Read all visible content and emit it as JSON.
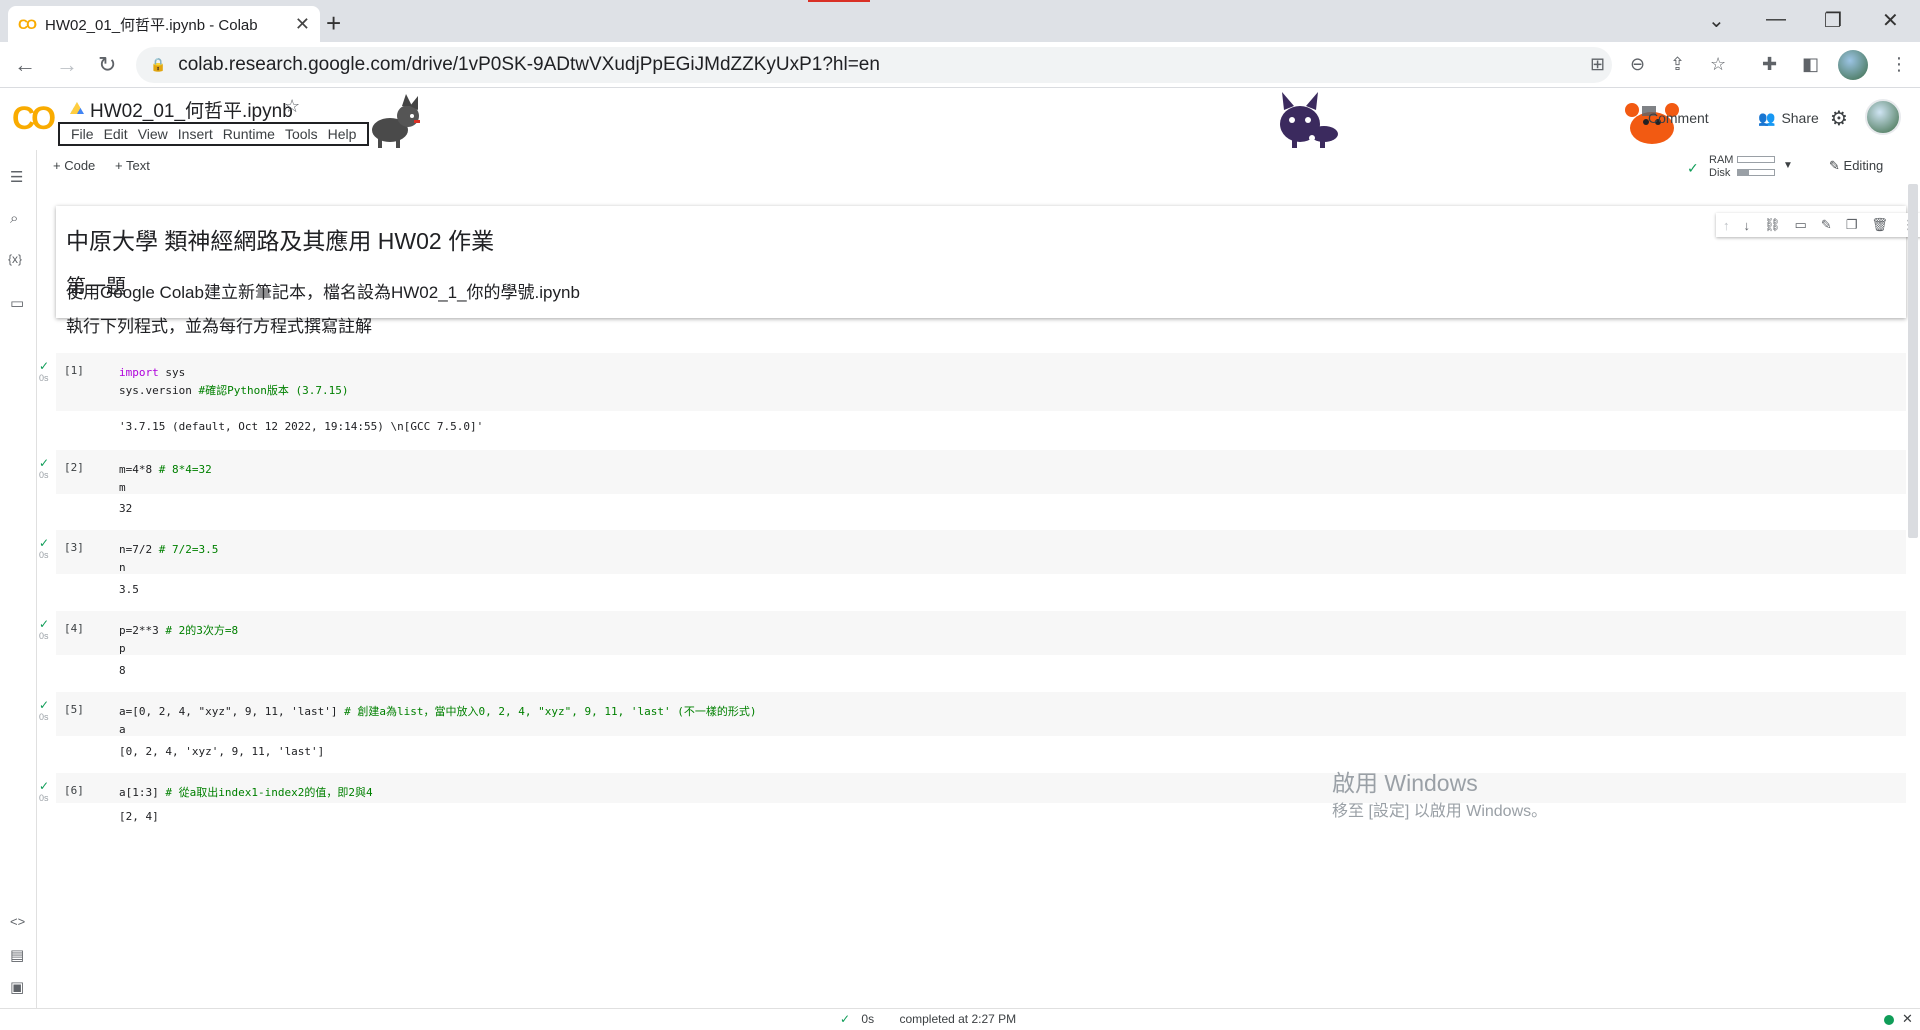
{
  "browser": {
    "tab_title": "HW02_01_何哲平.ipynb - Colab",
    "tab_icon": "CO",
    "new_tab": "+",
    "url": "colab.research.google.com/drive/1vP0SK-9ADtwVXudjPpEGiJMdZZKyUxP1?hl=en",
    "window_controls": [
      "⌄",
      "—",
      "❐",
      "✕"
    ]
  },
  "colab": {
    "logo": "CO",
    "notebook_title": "HW02_01_何哲平.ipynb",
    "menu": [
      "File",
      "Edit",
      "View",
      "Insert",
      "Runtime",
      "Tools",
      "Help"
    ],
    "comment_label": "Comment",
    "share_label": "Share"
  },
  "toolbar": {
    "add_code": "+ Code",
    "add_text": "+ Text",
    "ram_label": "RAM",
    "disk_label": "Disk",
    "editing_label": "Editing"
  },
  "text_cell": {
    "heading": "中原大學 類神經網路及其應用 HW02 作業",
    "subheading": "第一題"
  },
  "markdown": {
    "line1": "使用Google Colab建立新筆記本，檔名設為HW02_1_你的學號.ipynb",
    "line2": "執行下列程式，並為每行方程式撰寫註解"
  },
  "cells": [
    {
      "exec": "[1]",
      "secs": "0s",
      "output": "'3.7.15 (default, Oct 12 2022, 19:14:55) \\n[GCC 7.5.0]'"
    },
    {
      "exec": "[2]",
      "secs": "0s",
      "output": "32"
    },
    {
      "exec": "[3]",
      "secs": "0s",
      "output": "3.5"
    },
    {
      "exec": "[4]",
      "secs": "0s",
      "output": "8"
    },
    {
      "exec": "[5]",
      "secs": "0s",
      "output": "[0, 2, 4, 'xyz', 9, 11, 'last']"
    },
    {
      "exec": "[6]",
      "secs": "0s",
      "output": "[2, 4]"
    }
  ],
  "code_lines": {
    "c1_l1_kw": "import",
    "c1_l1": " sys",
    "c1_l2": "sys.version ",
    "c1_l2_cm": "#確認Python版本 (3.7.15)",
    "c2_l1": "m=4*8 ",
    "c2_l1_cm": "# 8*4=32",
    "c2_l2": "m",
    "c3_l1": "n=7/2 ",
    "c3_l1_cm": "# 7/2=3.5",
    "c3_l2": "n",
    "c4_l1": "p=2**3 ",
    "c4_l1_cm": "# 2的3次方=8",
    "c4_l2": "p",
    "c5_l1": "a=[0, 2, 4, \"xyz\", 9, 11, 'last'] ",
    "c5_l1_cm": "# 創建a為list，當中放入0, 2, 4, \"xyz\", 9, 11, 'last' (不一樣的形式)",
    "c5_l2": "a",
    "c6_l1": "a[1:3] ",
    "c6_l1_cm": "# 從a取出index1-index2的值，即2與4"
  },
  "watermark": {
    "line1": "啟用 Windows",
    "line2": "移至 [設定] 以啟用 Windows。"
  },
  "status": {
    "check": "✓",
    "duration": "0s",
    "completed": "completed at 2:27 PM"
  },
  "colors": {
    "colab_orange": "#f9ab00",
    "success_green": "#0f9d58",
    "code_bg": "#f7f7f7"
  }
}
